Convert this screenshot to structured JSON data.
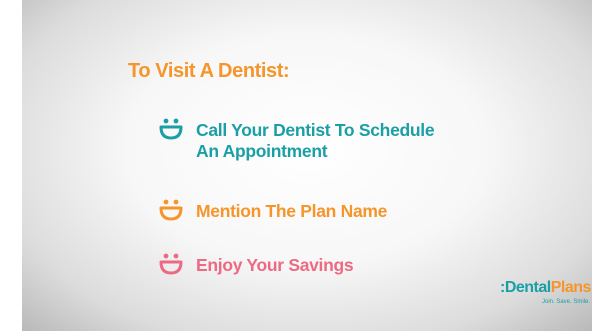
{
  "slide": {
    "heading": "To Visit A Dentist:",
    "steps": [
      {
        "icon": "smile-icon",
        "color": "#1a9fa6",
        "line1": "Call Your Dentist To Schedule",
        "line2": "An Appointment"
      },
      {
        "icon": "smile-icon",
        "color": "#f5952a",
        "line1": "Mention The Plan Name"
      },
      {
        "icon": "smile-icon",
        "color": "#ec6b82",
        "line1": "Enjoy Your Savings"
      }
    ]
  },
  "logo": {
    "prefix": ":",
    "part1": "Dental",
    "part2": "Plans",
    "tagline": "Join. Save. Smile.",
    "colors": {
      "primary": "#1a9fa6",
      "accent": "#f5952a"
    }
  }
}
